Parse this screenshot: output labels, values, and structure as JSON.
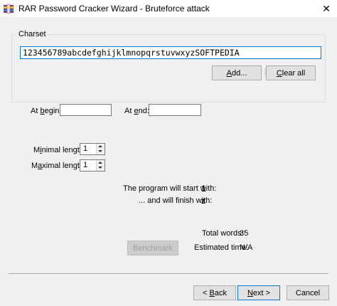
{
  "window": {
    "title": "RAR Password Cracker Wizard - Bruteforce attack",
    "close_glyph": "✕"
  },
  "charset": {
    "group_label": "Charset",
    "value": "123456789abcdefghijklmnopqrstuvwxyzSOFTPEDIA",
    "add_label_u": "A",
    "add_label_rest": "dd...",
    "clear_label_u": "C",
    "clear_label_rest": "lear all"
  },
  "watermark": "SOFTPEDIA",
  "range": {
    "begin_label_pre": "At ",
    "begin_label_u": "b",
    "begin_label_post": "egin:",
    "end_label_pre": "At ",
    "end_label_u": "e",
    "end_label_post": "nd:",
    "begin_value": "",
    "end_value": ""
  },
  "length": {
    "min_label_pre": "M",
    "min_label_u": "i",
    "min_label_post": "nimal length:",
    "max_label_pre": "M",
    "max_label_u": "a",
    "max_label_post": "ximal length:",
    "min_value": "1",
    "max_value": "1"
  },
  "info": {
    "start_label": "The program will start with:",
    "start_value": "1",
    "finish_label": "... and will finish with:",
    "finish_value": "z",
    "total_label": "Total words:",
    "total_value": "35",
    "time_label": "Estimated time:",
    "time_value": "N/A",
    "benchmark_label": "Benchmark"
  },
  "nav": {
    "back_prefix": "< ",
    "back_u": "B",
    "back_rest": "ack",
    "next_u": "N",
    "next_rest": "ext >",
    "cancel_label": "Cancel"
  },
  "colors": {
    "accent": "#0078d7",
    "dialog_bg": "#f0f0f0"
  }
}
